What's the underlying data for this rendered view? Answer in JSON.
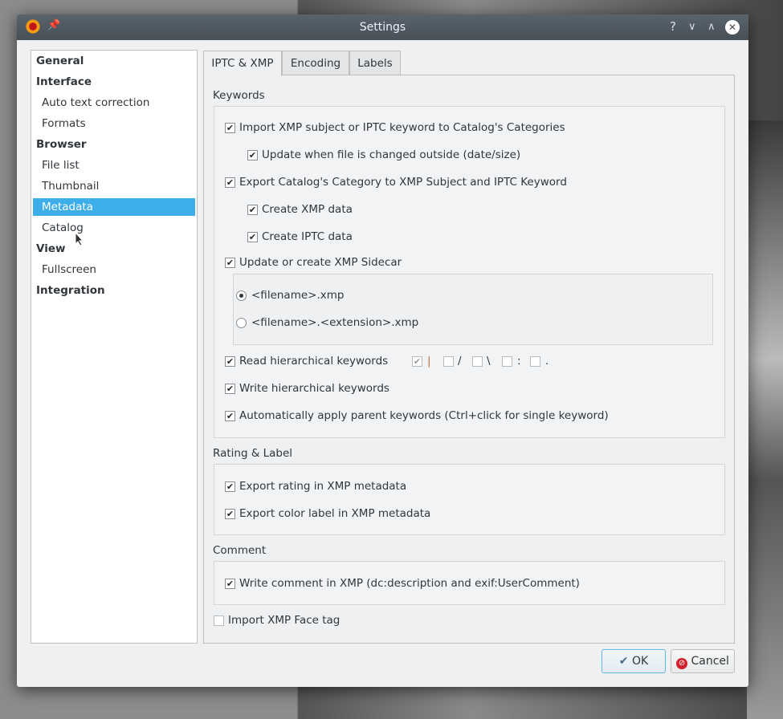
{
  "window": {
    "title": "Settings"
  },
  "sidebar": {
    "items": [
      {
        "label": "General",
        "type": "header"
      },
      {
        "label": "Interface",
        "type": "header"
      },
      {
        "label": "Auto text correction",
        "type": "sub"
      },
      {
        "label": "Formats",
        "type": "sub"
      },
      {
        "label": "Browser",
        "type": "header"
      },
      {
        "label": "File list",
        "type": "sub"
      },
      {
        "label": "Thumbnail",
        "type": "sub"
      },
      {
        "label": "Metadata",
        "type": "sub",
        "selected": true
      },
      {
        "label": "Catalog",
        "type": "sub"
      },
      {
        "label": "View",
        "type": "header"
      },
      {
        "label": "Fullscreen",
        "type": "sub"
      },
      {
        "label": "Integration",
        "type": "header"
      }
    ]
  },
  "tabs": [
    {
      "label": "IPTC & XMP",
      "active": true
    },
    {
      "label": "Encoding"
    },
    {
      "label": "Labels"
    }
  ],
  "keywords": {
    "label": "Keywords",
    "import_subject": {
      "label": "Import XMP subject or IPTC keyword to Catalog's Categories",
      "checked": true
    },
    "update_changed": {
      "label": "Update when file is changed outside (date/size)",
      "checked": true
    },
    "export_category": {
      "label": "Export Catalog's Category to XMP Subject and IPTC Keyword",
      "checked": true
    },
    "create_xmp": {
      "label": "Create XMP data",
      "checked": true
    },
    "create_iptc": {
      "label": "Create IPTC data",
      "checked": true
    },
    "sidecar": {
      "label": "Update or create XMP Sidecar",
      "checked": true
    },
    "sidecar_opt1": {
      "label": "<filename>.xmp",
      "selected": true
    },
    "sidecar_opt2": {
      "label": "<filename>.<extension>.xmp",
      "selected": false
    },
    "read_hier": {
      "label": "Read hierarchical keywords",
      "checked": true
    },
    "separators": [
      {
        "char": "|",
        "checked": true
      },
      {
        "char": "/",
        "checked": false
      },
      {
        "char": "\\",
        "checked": false
      },
      {
        "char": ":",
        "checked": false
      },
      {
        "char": ".",
        "checked": false
      }
    ],
    "write_hier": {
      "label": "Write hierarchical keywords",
      "checked": true
    },
    "auto_parent": {
      "label": "Automatically apply parent keywords (Ctrl+click for single keyword)",
      "checked": true
    }
  },
  "rating": {
    "label": "Rating & Label",
    "export_rating": {
      "label": "Export rating in XMP metadata",
      "checked": true
    },
    "export_color": {
      "label": "Export color label in XMP metadata",
      "checked": true
    }
  },
  "comment": {
    "label": "Comment",
    "write_comment": {
      "label": "Write comment in XMP (dc:description and exif:UserComment)",
      "checked": true
    }
  },
  "face_tag": {
    "label": "Import XMP Face tag",
    "checked": false
  },
  "buttons": {
    "ok": "OK",
    "cancel": "Cancel"
  },
  "check_mark": "✔"
}
